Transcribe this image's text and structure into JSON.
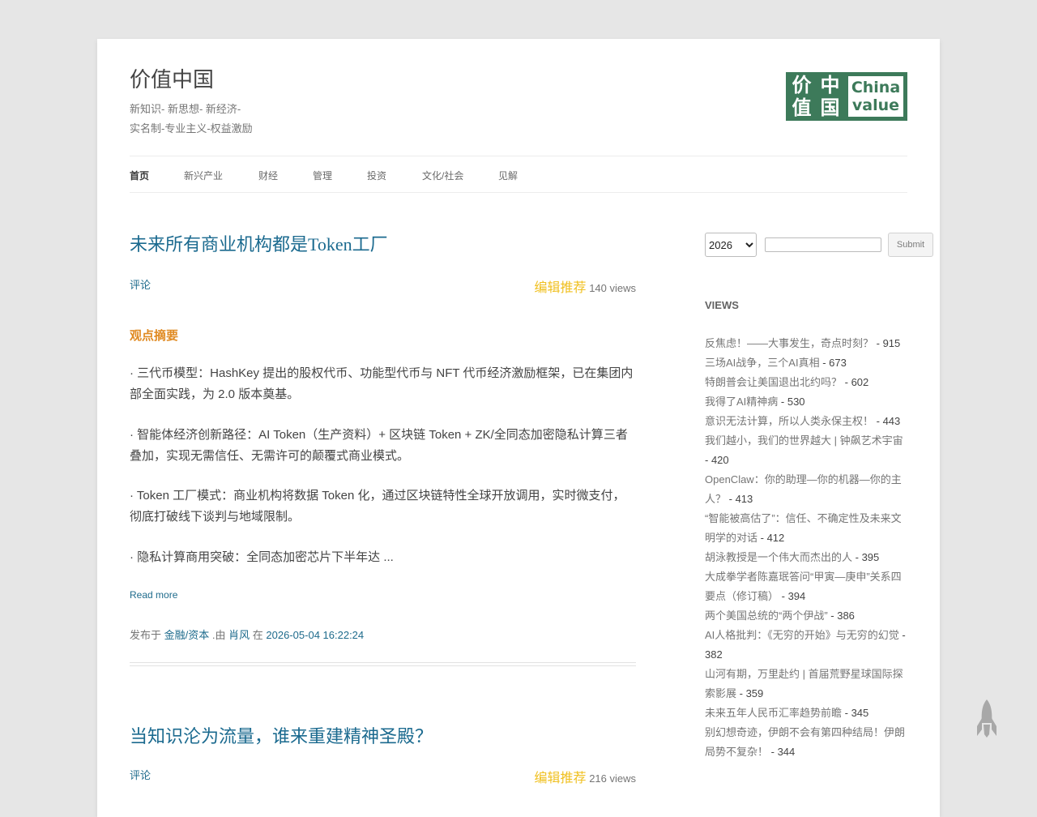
{
  "header": {
    "site_title": "价值中国",
    "tagline_line1": "新知识- 新思想- 新经济-",
    "tagline_line2": "实名制-专业主义-权益激励",
    "logo": {
      "cn_chars": [
        "价",
        "中",
        "值",
        "国"
      ],
      "en_line1": "China",
      "en_line2": "value",
      "color": "#3d7a5a"
    }
  },
  "nav": {
    "items": [
      {
        "label": "首页",
        "active": true
      },
      {
        "label": "新兴产业"
      },
      {
        "label": "财经"
      },
      {
        "label": "管理"
      },
      {
        "label": "投资"
      },
      {
        "label": "文化/社会"
      },
      {
        "label": "见解"
      }
    ]
  },
  "posts": [
    {
      "title": "未来所有商业机构都是Token工厂",
      "comments_label": "评论",
      "recommend_label": "编辑推荐",
      "views": "140 views",
      "summary_heading": "观点摘要",
      "bullets": [
        "· 三代币模型：HashKey 提出的股权代币、功能型代币与 NFT 代币经济激励框架，已在集团内部全面实践，为 2.0 版本奠基。",
        "· 智能体经济创新路径：AI Token（生产资料）+ 区块链 Token + ZK/全同态加密隐私计算三者叠加，实现无需信任、无需许可的颠覆式商业模式。",
        "· Token 工厂模式：商业机构将数据 Token 化，通过区块链特性全球开放调用，实时微支付，彻底打破线下谈判与地域限制。",
        "· 隐私计算商用突破：全同态加密芯片下半年达 ..."
      ],
      "read_more": "Read more",
      "meta": {
        "published_in": "发布于",
        "category": "金融/资本",
        "by": ".由",
        "author": "肖风",
        "at": "在",
        "datetime": "2026-05-04 16:22:24"
      }
    },
    {
      "title": "当知识沦为流量，谁来重建精神圣殿？",
      "comments_label": "评论",
      "recommend_label": "编辑推荐",
      "views": "216 views"
    }
  ],
  "sidebar": {
    "year_value": "2026",
    "submit_label": "Submit",
    "views_heading": "VIEWS",
    "views_items": [
      {
        "title": "反焦虑！——大事发生，奇点时刻？",
        "count": " - 915"
      },
      {
        "title": "三场AI战争，三个AI真相",
        "count": " - 673"
      },
      {
        "title": "特朗普会让美国退出北约吗？",
        "count": " - 602"
      },
      {
        "title": "我得了AI精神病",
        "count": " - 530"
      },
      {
        "title": "意识无法计算，所以人类永保主权！",
        "count": " - 443"
      },
      {
        "title": "我们越小，我们的世界越大 | 钟飙艺术宇宙",
        "count": " - 420"
      },
      {
        "title": "OpenClaw：你的助理—你的机器—你的主人？",
        "count": " - 413"
      },
      {
        "title": "“智能被高估了”：信任、不确定性及未来文明学的对话",
        "count": " - 412"
      },
      {
        "title": "胡泳教授是一个伟大而杰出的人",
        "count": " - 395"
      },
      {
        "title": "大成拳学者陈嘉珉答问“甲寅—庚申”关系四要点（修订稿）",
        "count": " - 394"
      },
      {
        "title": "两个美国总统的“两个伊战”",
        "count": " - 386"
      },
      {
        "title": "AI人格批判：《无穷的开始》与无穷的幻觉",
        "count": " - 382"
      },
      {
        "title": "山河有期，万里赴约 | 首届荒野星球国际探索影展",
        "count": " - 359"
      },
      {
        "title": "未来五年人民币汇率趋势前瞻",
        "count": " - 345"
      },
      {
        "title": "别幻想奇迹，伊朗不会有第四种结局！伊朗局势不复杂！",
        "count": " - 344"
      }
    ]
  }
}
